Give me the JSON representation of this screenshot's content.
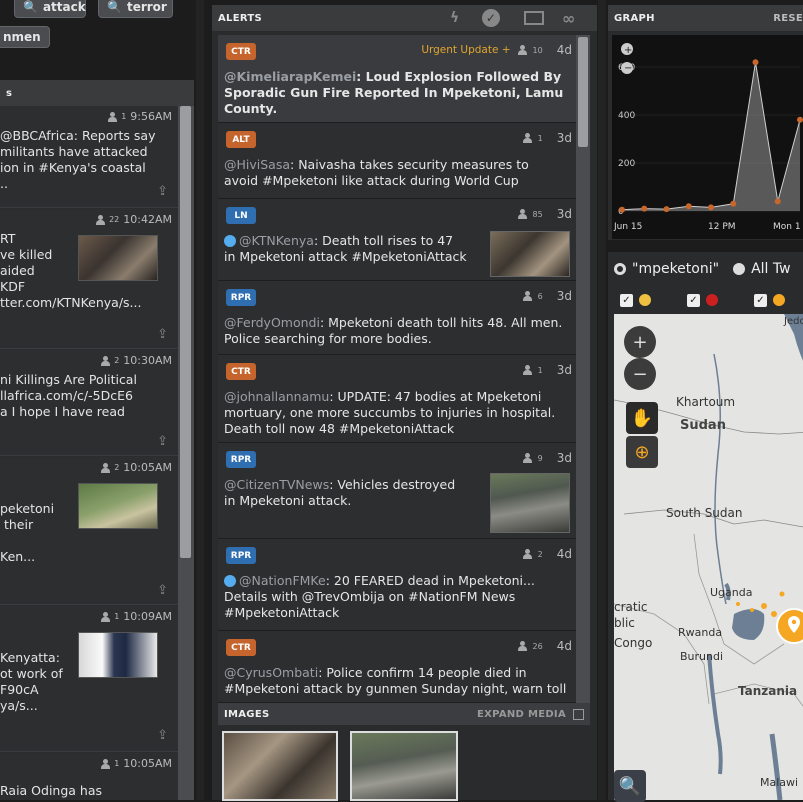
{
  "top_chips": [
    {
      "label": "attack"
    },
    {
      "label": "terror"
    },
    {
      "label": "nmen"
    }
  ],
  "left_feed": {
    "header_fragment": "s",
    "items": [
      {
        "count": "1",
        "time": "9:56AM",
        "lines": "@BBCAfrica: Reports say\nmilitants have attacked\nion in #Kenya's coastal\n.. "
      },
      {
        "count": "22",
        "time": "10:42AM",
        "lines": "RT\nve killed\naided\nKDF\ntter.com/KTNKenya/s..."
      },
      {
        "count": "2",
        "time": "10:30AM",
        "lines": "ni Killings Are Political\nllafrica.com/c/-5DcE6\na I hope I have read"
      },
      {
        "count": "2",
        "time": "10:05AM",
        "lines": "peketoni\n their\n\nKen..."
      },
      {
        "count": "1",
        "time": "10:09AM",
        "lines": "Kenyatta:\not work of\nF90cA\nya/s..."
      },
      {
        "count": "1",
        "time": "10:05AM",
        "lines": "Raia Odinga has"
      }
    ]
  },
  "alerts": {
    "title": "ALERTS",
    "items": [
      {
        "tag": "CTR",
        "urgent": "Urgent Update +",
        "count": "10",
        "age": "4d",
        "handle": "@KimeliarapKemei",
        "text": ": Loud Explosion Followed By\nSporadic Gun Fire Reported In Mpeketoni, Lamu\nCounty.",
        "verified": false
      },
      {
        "tag": "ALT",
        "urgent": "",
        "count": "1",
        "age": "3d",
        "handle": "@HiviSasa",
        "text": ": Naivasha takes security measures to\navoid #Mpeketoni like attack during World Cup",
        "verified": false
      },
      {
        "tag": "LN",
        "urgent": "",
        "count": "85",
        "age": "3d",
        "handle": "@KTNKenya",
        "text": ": Death toll rises to 47\nin Mpeketoni attack #MpeketoniAttack",
        "verified": true
      },
      {
        "tag": "RPR",
        "urgent": "",
        "count": "6",
        "age": "3d",
        "handle": "@FerdyOmondi",
        "text": ": Mpeketoni death toll hits 48. All men.\nPolice searching for more bodies.",
        "verified": false
      },
      {
        "tag": "CTR",
        "urgent": "",
        "count": "1",
        "age": "3d",
        "handle": "@johnallannamu",
        "text": ": UPDATE: 47 bodies at Mpeketoni\nmortuary, one more succumbs to injuries in hospital.\nDeath toll now 48 #MpeketoniAttack",
        "verified": false
      },
      {
        "tag": "RPR",
        "urgent": "",
        "count": "9",
        "age": "3d",
        "handle": "@CitizenTVNews",
        "text": ": Vehicles destroyed\nin Mpeketoni attack.",
        "verified": false
      },
      {
        "tag": "RPR",
        "urgent": "",
        "count": "2",
        "age": "4d",
        "handle": "@NationFMKe",
        "text": ": 20 FEARED dead in Mpeketoni...\nDetails with @TrevOmbija on #NationFM News\n#MpeketoniAttack",
        "verified": true
      },
      {
        "tag": "CTR",
        "urgent": "",
        "count": "26",
        "age": "4d",
        "handle": "@CyrusOmbati",
        "text": ": Police confirm 14 people died in\n#Mpeketoni attack by gunmen Sunday night, warn toll",
        "verified": false
      }
    ],
    "images_title": "IMAGES",
    "expand_media": "EXPAND MEDIA"
  },
  "graph": {
    "title": "GRAPH",
    "reset": "RESE",
    "y_ticks": [
      "600",
      "400",
      "200",
      "0"
    ],
    "x_ticks": [
      "Jun 15",
      "12 PM",
      "Mon 1"
    ]
  },
  "chart_data": {
    "type": "line",
    "title": "",
    "xlabel": "",
    "ylabel": "",
    "categories": [
      "Jun 15",
      "",
      "",
      "",
      "12 PM",
      "",
      "",
      "",
      "Mon 1"
    ],
    "series": [
      {
        "values": [
          5,
          10,
          8,
          20,
          15,
          30,
          620,
          40,
          380
        ]
      }
    ],
    "ylim": [
      0,
      700
    ]
  },
  "map": {
    "search_options": [
      "\"mpeketoni\"",
      "All Tw"
    ],
    "labels": {
      "khartoum": "Khartoum",
      "sudan": "Sudan",
      "south_sudan": "South Sudan",
      "uganda": "Uganda",
      "rwanda": "Rwanda",
      "burundi": "Burundi",
      "congo1": "cratic",
      "congo2": "blic",
      "congo3": "Congo",
      "tanzania": "Tanzania",
      "malawi": "Malawi",
      "jeddah": "Jedd"
    },
    "colors": {
      "water": "#6d7f94",
      "land": "#e7e7e5",
      "marker": "#f5a623"
    }
  }
}
